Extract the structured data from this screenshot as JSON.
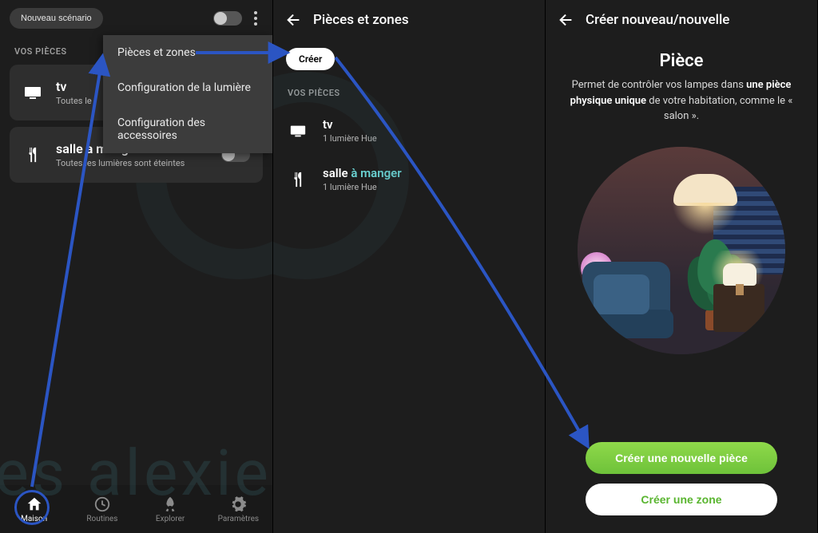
{
  "watermark": "les alexiens",
  "panel1": {
    "new_scenario": "Nouveau scénario",
    "section_label": "VOS PIÈCES",
    "rooms": [
      {
        "icon": "tv",
        "name": "tv",
        "sub": "Toutes le"
      },
      {
        "icon": "cutlery",
        "name": "salle a manger",
        "sub": "Toutes les lumières sont éteintes"
      }
    ],
    "dropdown": {
      "item1": "Pièces et zones",
      "item2": "Configuration de la lumière",
      "item3": "Configuration des accessoires"
    },
    "nav": {
      "home": "Maison",
      "routines": "Routines",
      "explore": "Explorer",
      "settings": "Paramètres"
    }
  },
  "panel2": {
    "title": "Pièces et zones",
    "create": "Créer",
    "section_label": "VOS PIÈCES",
    "rooms": [
      {
        "name": "tv",
        "sub": "1 lumière Hue"
      },
      {
        "name_prefix": "salle",
        "name_accent": " à manger",
        "sub": "1 lumière Hue"
      }
    ]
  },
  "panel3": {
    "title": "Créer nouveau/nouvelle",
    "heading": "Pièce",
    "desc_pre": "Permet de contrôler vos lampes dans ",
    "desc_bold": "une pièce physique unique",
    "desc_post": " de votre habitation, comme le « salon ».",
    "btn_room": "Créer une nouvelle pièce",
    "btn_zone": "Créer une zone"
  }
}
